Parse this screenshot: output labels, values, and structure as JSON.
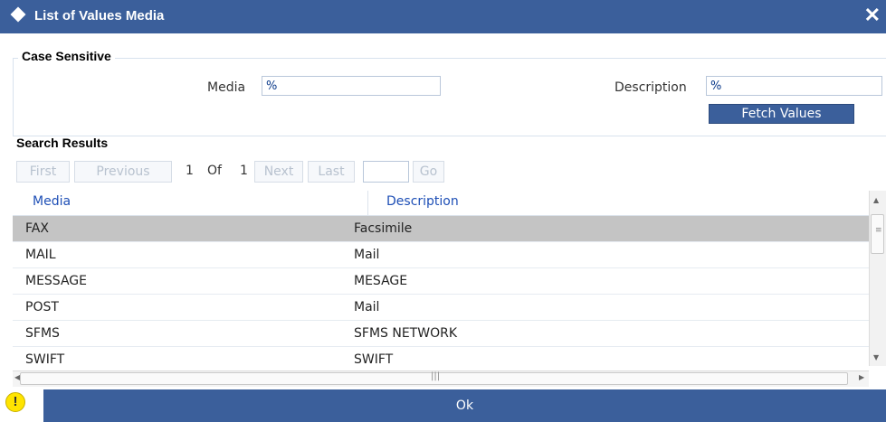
{
  "window": {
    "title": "List of Values Media",
    "close_glyph": "✕"
  },
  "criteria": {
    "legend": "Case Sensitive",
    "media_label": "Media",
    "media_value": "%",
    "description_label": "Description",
    "description_value": "%",
    "fetch_label": "Fetch Values"
  },
  "results": {
    "heading": "Search Results",
    "pager": {
      "first": "First",
      "previous": "Previous",
      "current": "1",
      "of": "Of",
      "total": "1",
      "next": "Next",
      "last": "Last",
      "page_input": "",
      "go": "Go"
    },
    "columns": [
      "Media",
      "Description"
    ],
    "rows": [
      {
        "media": "FAX",
        "description": "Facsimile",
        "selected": true
      },
      {
        "media": "MAIL",
        "description": "Mail"
      },
      {
        "media": "MESSAGE",
        "description": "MESAGE"
      },
      {
        "media": "POST",
        "description": "Mail"
      },
      {
        "media": "SFMS",
        "description": "SFMS NETWORK"
      },
      {
        "media": "SWIFT",
        "description": "SWIFT"
      }
    ]
  },
  "footer": {
    "ok_label": "Ok",
    "warning_glyph": "!"
  },
  "colors": {
    "titlebar": "#3b5f9b",
    "header_text": "#1e4fb6",
    "selected_row": "#c4c4c4",
    "warning": "#ffe400"
  },
  "icons": {
    "title": "diamond-icon",
    "close": "close-icon",
    "warning": "warning-icon"
  }
}
